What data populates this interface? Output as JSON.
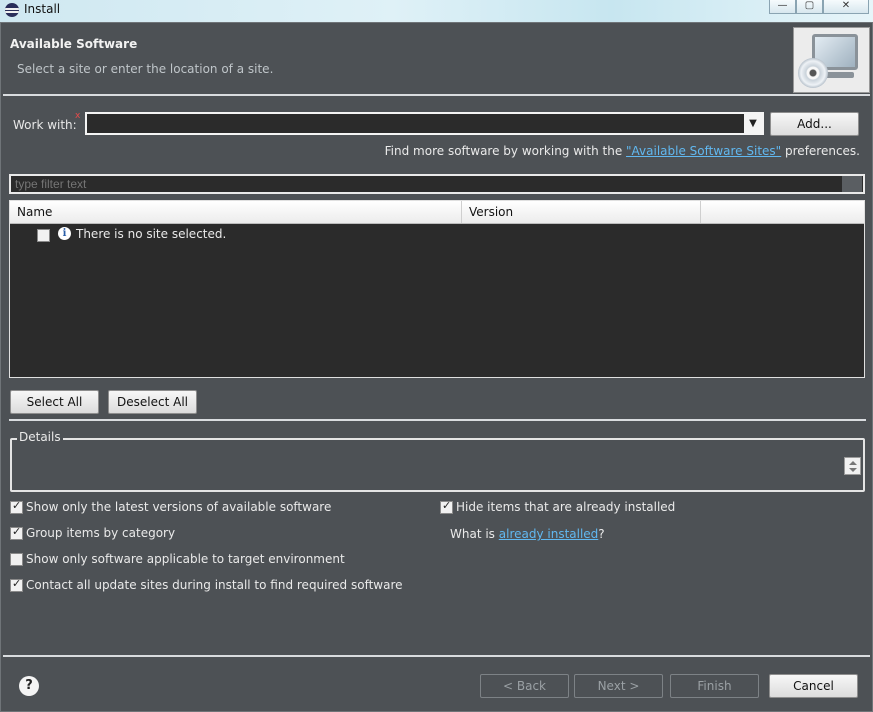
{
  "window": {
    "title": "Install",
    "controls": [
      "—",
      "▢",
      "✕"
    ]
  },
  "banner": {
    "title": "Available Software",
    "subtitle": "Select a site or enter the location of a site."
  },
  "work_with": {
    "label": "Work with:",
    "value": "",
    "required_marker": "x"
  },
  "buttons": {
    "add": "Add...",
    "select_all": "Select All",
    "deselect_all": "Deselect All",
    "back": "< Back",
    "next": "Next >",
    "finish": "Finish",
    "cancel": "Cancel"
  },
  "find_more": {
    "prefix": "Find more software by working with the ",
    "link": "\"Available Software Sites\"",
    "suffix": " preferences."
  },
  "filter": {
    "placeholder": "type filter text"
  },
  "tree": {
    "columns": [
      "Name",
      "Version",
      ""
    ],
    "rows": [
      {
        "checked": false,
        "icon": "info-icon",
        "text": "There is no site selected."
      }
    ]
  },
  "details": {
    "label": "Details"
  },
  "options": [
    {
      "label": "Show only the latest versions of available software",
      "checked": true
    },
    {
      "label": "Group items by category",
      "checked": true
    },
    {
      "label": "Show only software applicable to target environment",
      "checked": false
    },
    {
      "label": "Contact all update sites during install to find required software",
      "checked": true
    },
    {
      "label": "Hide items that are already installed",
      "checked": true
    }
  ],
  "already_installed": {
    "prefix": "What is ",
    "link": "already installed",
    "suffix": "?"
  },
  "help": {
    "icon": "help-icon",
    "glyph": "?"
  }
}
